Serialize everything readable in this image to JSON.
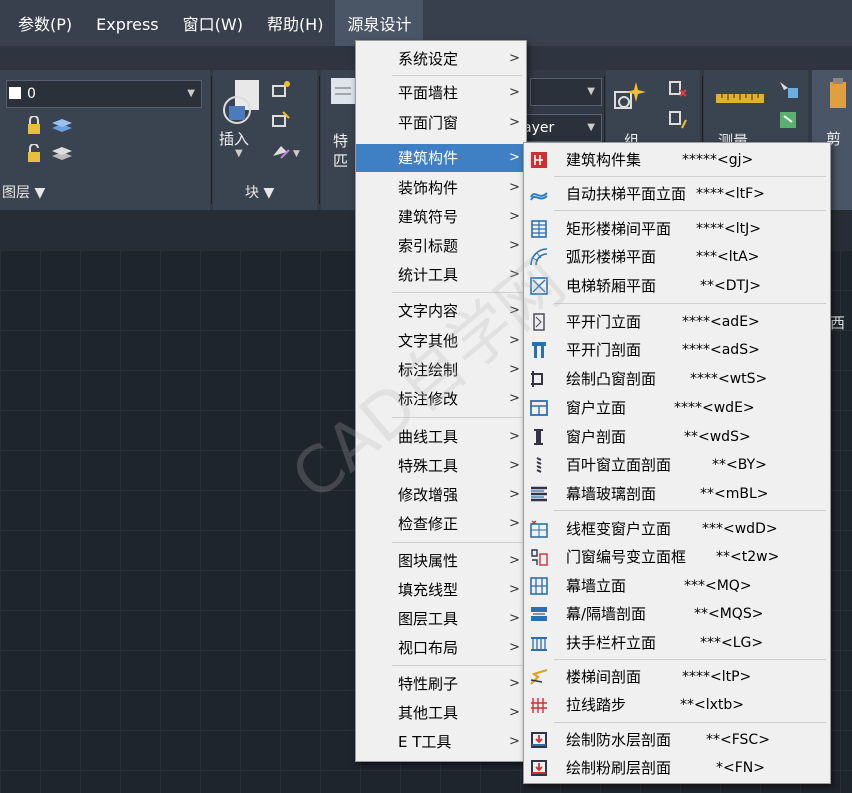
{
  "menubar": {
    "items": [
      "参数(P)",
      "Express",
      "窗口(W)",
      "帮助(H)",
      "源泉设计"
    ]
  },
  "ribbon": {
    "layer_value": "0",
    "layer_combo2_value": "ayer",
    "panels": {
      "layers_title": "图层 ▼",
      "block_title": "块 ▼",
      "insert_label": "插入",
      "properties_label_1": "特",
      "properties_label_2": "匹",
      "group_label": "组",
      "measure_label": "测量",
      "clipboard_label": "剪"
    },
    "right_edge_text": "西"
  },
  "menu1": {
    "items": [
      {
        "label": "系统设定"
      },
      {
        "label": "平面墙柱"
      },
      {
        "label": "平面门窗"
      },
      {
        "label": "建筑构件"
      },
      {
        "label": "装饰构件"
      },
      {
        "label": "建筑符号"
      },
      {
        "label": "索引标题"
      },
      {
        "label": "统计工具"
      },
      {
        "label": "文字内容"
      },
      {
        "label": "文字其他"
      },
      {
        "label": "标注绘制"
      },
      {
        "label": "标注修改"
      },
      {
        "label": "曲线工具"
      },
      {
        "label": "特殊工具"
      },
      {
        "label": "修改增强"
      },
      {
        "label": "检查修正"
      },
      {
        "label": "图块属性"
      },
      {
        "label": "填充线型"
      },
      {
        "label": "图层工具"
      },
      {
        "label": "视口布局"
      },
      {
        "label": "特性刷子"
      },
      {
        "label": "其他工具"
      },
      {
        "label": "E T工具"
      }
    ],
    "arrow": ">"
  },
  "menu2": {
    "items": [
      {
        "label": "建筑构件集",
        "cmd": "*****<gj>"
      },
      {
        "label": "自动扶梯平面立面",
        "cmd": "****<ltF>"
      },
      {
        "label": "矩形楼梯间平面",
        "cmd": "****<ltJ>"
      },
      {
        "label": "弧形楼梯平面",
        "cmd": "***<ltA>"
      },
      {
        "label": "电梯轿厢平面",
        "cmd": "**<DTJ>"
      },
      {
        "label": "平开门立面",
        "cmd": "****<adE>"
      },
      {
        "label": "平开门剖面",
        "cmd": "****<adS>"
      },
      {
        "label": "绘制凸窗剖面",
        "cmd": "****<wtS>"
      },
      {
        "label": "窗户立面",
        "cmd": "****<wdE>"
      },
      {
        "label": "窗户剖面",
        "cmd": "**<wdS>"
      },
      {
        "label": "百叶窗立面剖面",
        "cmd": "**<BY>"
      },
      {
        "label": "幕墙玻璃剖面",
        "cmd": "**<mBL>"
      },
      {
        "label": "线框变窗户立面",
        "cmd": "***<wdD>"
      },
      {
        "label": "门窗编号变立面框",
        "cmd": "**<t2w>"
      },
      {
        "label": "幕墙立面",
        "cmd": "***<MQ>"
      },
      {
        "label": "幕/隔墙剖面",
        "cmd": "**<MQS>"
      },
      {
        "label": "扶手栏杆立面",
        "cmd": "***<LG>"
      },
      {
        "label": "楼梯间剖面",
        "cmd": "****<ltP>"
      },
      {
        "label": "拉线踏步",
        "cmd": "**<lxtb>"
      },
      {
        "label": "绘制防水层剖面",
        "cmd": "**<FSC>"
      },
      {
        "label": "绘制粉刷层剖面",
        "cmd": "*<FN>"
      }
    ]
  },
  "watermark": "CAD自学网"
}
